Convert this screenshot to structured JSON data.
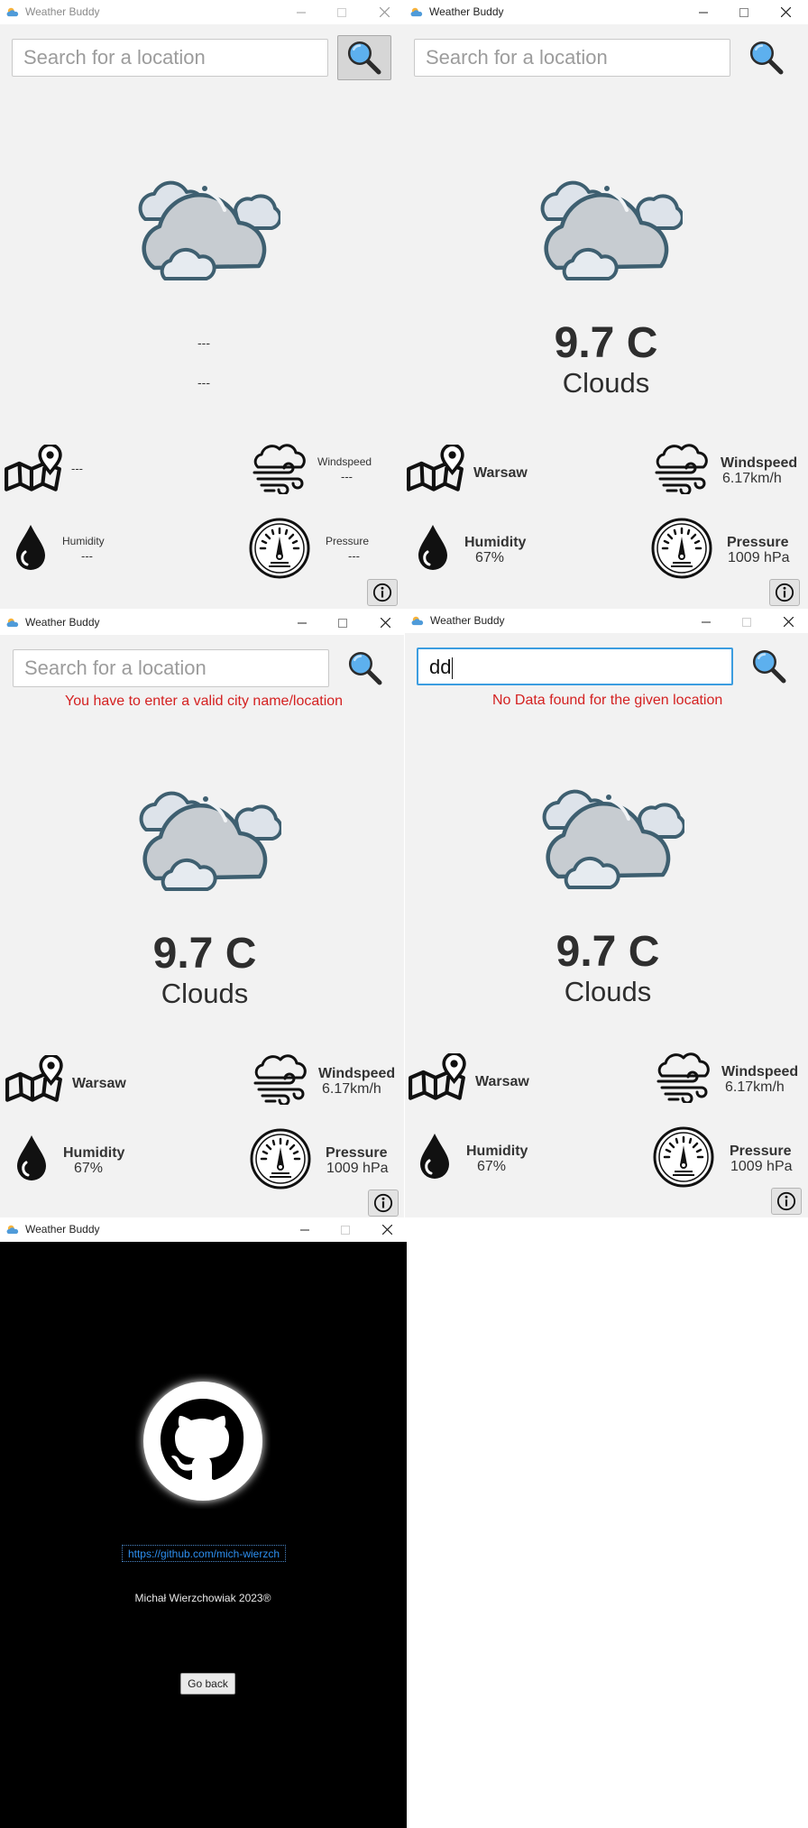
{
  "app": {
    "title": "Weather Buddy"
  },
  "search": {
    "placeholder": "Search for a location"
  },
  "window_empty": {
    "temp": "---",
    "description": "---",
    "location": "---",
    "windspeed_label": "Windspeed",
    "windspeed_value": "---",
    "humidity_label": "Humidity",
    "humidity_value": "---",
    "pressure_label": "Pressure",
    "pressure_value": "---"
  },
  "weather": {
    "temp": "9.7 C",
    "description": "Clouds",
    "location": "Warsaw",
    "windspeed_label": "Windspeed",
    "windspeed_value": "6.17km/h",
    "humidity_label": "Humidity",
    "humidity_value": "67%",
    "pressure_label": "Pressure",
    "pressure_value": "1009 hPa"
  },
  "window_invalid": {
    "error": "You have to enter a valid city name/location"
  },
  "window_nodata": {
    "search_value": "dd",
    "error": "No Data found for the given location"
  },
  "about": {
    "link": "https://github.com/mich-wierzch",
    "copyright": "Michał Wierzchowiak 2023®",
    "go_back": "Go back"
  },
  "icons": [
    "app-icon",
    "minimize-icon",
    "maximize-icon",
    "close-icon",
    "search-icon",
    "cloud-icon",
    "map-pin-icon",
    "wind-icon",
    "droplet-icon",
    "gauge-icon",
    "info-icon",
    "github-icon"
  ]
}
